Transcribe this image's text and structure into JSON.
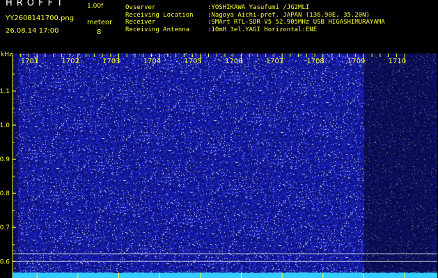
{
  "header": {
    "app_title": "HROFFT",
    "version": "1.00f",
    "filename": "YY2608141700.png",
    "datetime": "26.08.14 17:00",
    "mode_label": "meteor",
    "mode_count": "8"
  },
  "station_info": [
    {
      "key": "Ovserver",
      "value": ":YOSHIKAWA Yasufumi /JG2MLI"
    },
    {
      "key": "Receiving Location",
      "value": ":Nagoya Aichi-pref. JAPAN (136.90E, 35.20N)"
    },
    {
      "key": "Receiver",
      "value": ":SMArt RTL-SDR V5 52.905MHz USB HIGASHIMURAYAMA"
    },
    {
      "key": "Receiving Antenna",
      "value": ":10mH 3el.YAGI Horizontal:ENE"
    }
  ],
  "colors": {
    "text": "#ffff33",
    "tick": "#ffff33",
    "background": "#000000",
    "spectrum_low": "#0a0a6e",
    "spectrum_high": "#2a3cff",
    "speckle": "#ffffff",
    "baseline": "#33ccff",
    "reference_line": "#e8e8e8"
  },
  "chart_data": {
    "type": "heatmap",
    "x_unit": "minute (HHMM)",
    "x_ticks": [
      "1701",
      "1702",
      "1703",
      "1704",
      "1705",
      "1706",
      "1707",
      "1708",
      "1709",
      "1710"
    ],
    "xlim": [
      1700.4,
      1710.8
    ],
    "ylabel": "kHz",
    "y_ticks": [
      "1.1",
      "1.0",
      "0.9",
      "0.8",
      "0.7",
      "0.6"
    ],
    "y_tick_values": [
      1.1,
      1.0,
      0.9,
      0.8,
      0.7,
      0.6
    ],
    "ylim": [
      0.568,
      1.21
    ],
    "reference_lines_khz": [
      0.623,
      0.6
    ],
    "dimmer_region_from_minute": 1709.0
  }
}
